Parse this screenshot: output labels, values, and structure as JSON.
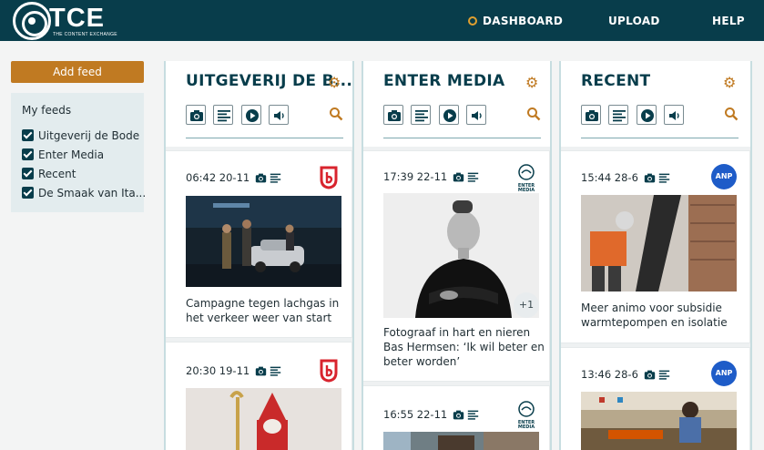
{
  "header": {
    "logo_text": "TCE",
    "logo_sub": "THE CONTENT EXCHANGE",
    "nav": [
      {
        "label": "DASHBOARD",
        "active": true
      },
      {
        "label": "UPLOAD",
        "active": false
      },
      {
        "label": "HELP",
        "active": false
      }
    ]
  },
  "colors": {
    "primary": "#083d4b",
    "accent": "#c07a22",
    "sidebar_bg": "#e3ecee"
  },
  "sidebar": {
    "add_feed_label": "Add feed",
    "title": "My feeds",
    "feeds": [
      {
        "label": "Uitgeverij de Bode",
        "checked": true
      },
      {
        "label": "Enter Media",
        "checked": true
      },
      {
        "label": "Recent",
        "checked": true
      },
      {
        "label": "De Smaak van Ita...",
        "checked": true
      }
    ]
  },
  "columns": [
    {
      "title": "UITGEVERIJ DE B...",
      "cards": [
        {
          "time": "06:42 20-11",
          "source_icon": "bode-logo-icon",
          "text": "Campagne tegen lachgas in het verkeer weer van start"
        },
        {
          "time": "20:30 19-11",
          "source_icon": "bode-logo-icon",
          "text": ""
        }
      ]
    },
    {
      "title": "ENTER MEDIA",
      "cards": [
        {
          "time": "17:39 22-11",
          "source_icon": "enter-media-logo-icon",
          "source_text": "ENTER MEDIA",
          "badge": "+1",
          "text": "Fotograaf in hart en nieren Bas Hermsen: ‘Ik wil beter en beter worden’"
        },
        {
          "time": "16:55 22-11",
          "source_icon": "enter-media-logo-icon",
          "source_text": "ENTER MEDIA",
          "text": ""
        }
      ]
    },
    {
      "title": "RECENT",
      "cards": [
        {
          "time": "15:44 28-6",
          "source_icon": "anp-logo-icon",
          "source_text": "ANP",
          "text": "Meer animo voor subsidie warmtepompen en isolatie"
        },
        {
          "time": "13:46 28-6",
          "source_icon": "anp-logo-icon",
          "source_text": "ANP",
          "text": ""
        }
      ]
    }
  ]
}
